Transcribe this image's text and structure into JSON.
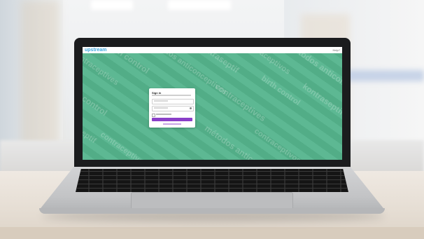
{
  "app": {
    "logo_text": "upstream",
    "topbar_right": "Help?",
    "background_words": [
      "birth control",
      "métodos anticonceptivos",
      "kontraseptif",
      "contraceptivos",
      "contraceptives"
    ]
  },
  "signin_card": {
    "title": "Sign in",
    "email_placeholder": "",
    "password_placeholder": "",
    "remember_label": "",
    "submit_label": "",
    "forgot_label": ""
  },
  "colors": {
    "pattern_green": "#5ab690",
    "logo_blue": "#3fa9e0",
    "button_purple": "#8a3fc8"
  }
}
